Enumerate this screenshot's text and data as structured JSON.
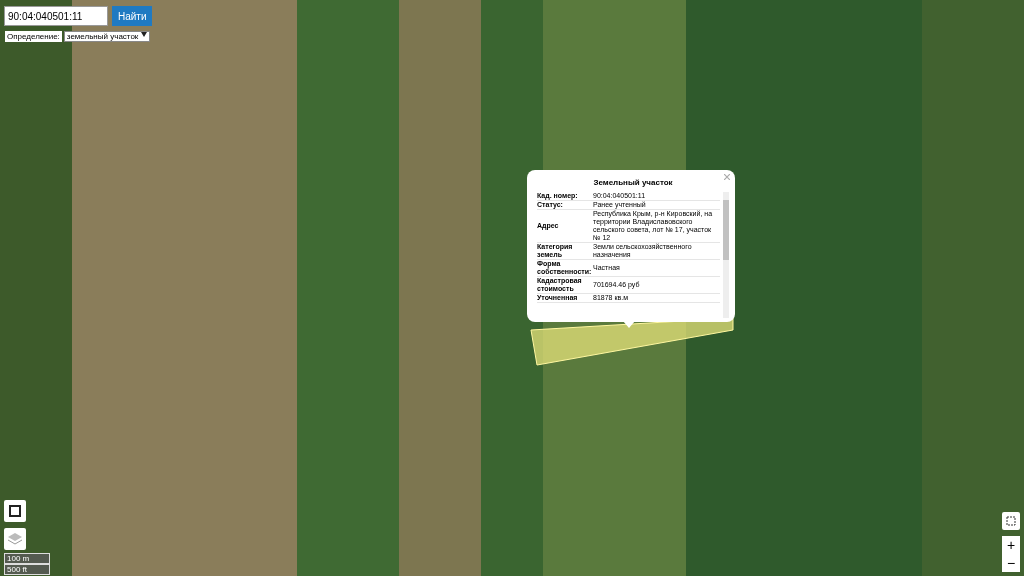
{
  "search": {
    "value": "90:04:040501:11",
    "button": "Найти"
  },
  "definition": {
    "label": "Определение:",
    "value": "земельный участок"
  },
  "popup": {
    "title": "Земельный участок",
    "rows": [
      {
        "label": "Кад. номер:",
        "value": "90:04:040501:11"
      },
      {
        "label": "Статус:",
        "value": "Ранее учтенный"
      },
      {
        "label": "Адрес",
        "value": "Республика Крым, р-н Кировский, на территории Владиславовского сельского совета, лот № 17, участок № 12"
      },
      {
        "label": "Категория земель",
        "value": "Земли сельскохозяйственного назначения"
      },
      {
        "label": "Форма собственности:",
        "value": "Частная"
      },
      {
        "label": "Кадастровая стоимость",
        "value": "701694.46 руб"
      },
      {
        "label": "Уточненная",
        "value": "81878 кв.м"
      }
    ]
  },
  "zoom": {
    "plus": "+",
    "minus": "−"
  },
  "scale": [
    "100 m",
    "500 ft"
  ]
}
